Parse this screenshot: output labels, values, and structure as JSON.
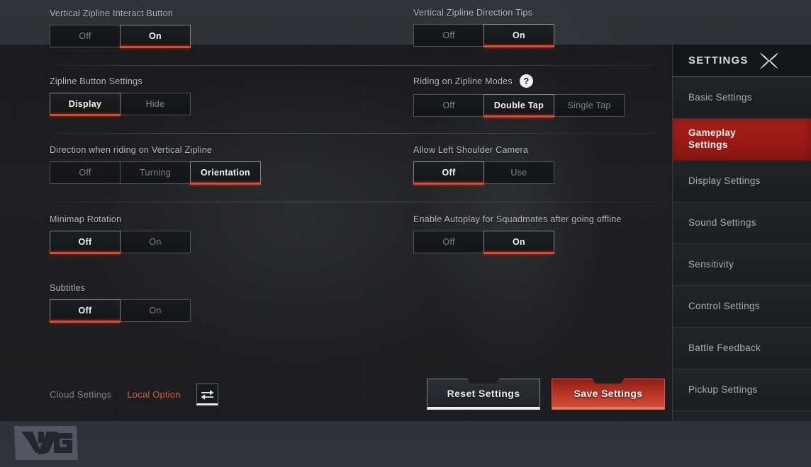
{
  "colors": {
    "accent_red": "#e8462a",
    "active_nav": "#a91f18",
    "panel_bg": "#1b1d20",
    "label_text": "#b9bdc4",
    "inactive_text": "#7d828b"
  },
  "sidebar": {
    "title": "SETTINGS",
    "close_icon": "close-x-icon",
    "items": [
      {
        "label": "Basic Settings",
        "active": false
      },
      {
        "label": "Gameplay\nSettings",
        "active": true
      },
      {
        "label": "Display Settings",
        "active": false
      },
      {
        "label": "Sound Settings",
        "active": false
      },
      {
        "label": "Sensitivity",
        "active": false
      },
      {
        "label": "Control Settings",
        "active": false
      },
      {
        "label": "Battle Feedback",
        "active": false
      },
      {
        "label": "Pickup Settings",
        "active": false
      }
    ]
  },
  "settings": {
    "left_column": [
      {
        "label": "Vertical Zipline Interact Button",
        "options": [
          "Off",
          "On"
        ],
        "selected": "On"
      },
      {
        "label": "Zipline Button Settings",
        "options": [
          "Display",
          "Hide"
        ],
        "selected": "Display"
      },
      {
        "label": "Direction when riding on Vertical Zipline",
        "options": [
          "Off",
          "Turning",
          "Orientation"
        ],
        "selected": "Orientation"
      },
      {
        "label": "Minimap Rotation",
        "options": [
          "Off",
          "On"
        ],
        "selected": "Off"
      },
      {
        "label": "Subtitles",
        "options": [
          "Off",
          "On"
        ],
        "selected": "Off"
      }
    ],
    "right_column": [
      {
        "label": "Vertical Zipline Direction Tips",
        "options": [
          "Off",
          "On"
        ],
        "selected": "On",
        "help": false
      },
      {
        "label": "Riding on Zipline Modes",
        "options": [
          "Off",
          "Double Tap",
          "Single Tap"
        ],
        "selected": "Double Tap",
        "help": true,
        "help_glyph": "?"
      },
      {
        "label": "Allow Left Shoulder Camera",
        "options": [
          "Off",
          "Use"
        ],
        "selected": "Off",
        "help": false
      },
      {
        "label": "Enable Autoplay for Squadmates after going offline",
        "options": [
          "Off",
          "On"
        ],
        "selected": "On",
        "help": false
      }
    ]
  },
  "footer": {
    "cloud_settings": "Cloud Settings",
    "local_option": "Local Option",
    "swap_icon": "swap-arrows-icon",
    "reset_button": "Reset Settings",
    "save_button": "Save Settings"
  },
  "watermark": {
    "text": "VG"
  }
}
